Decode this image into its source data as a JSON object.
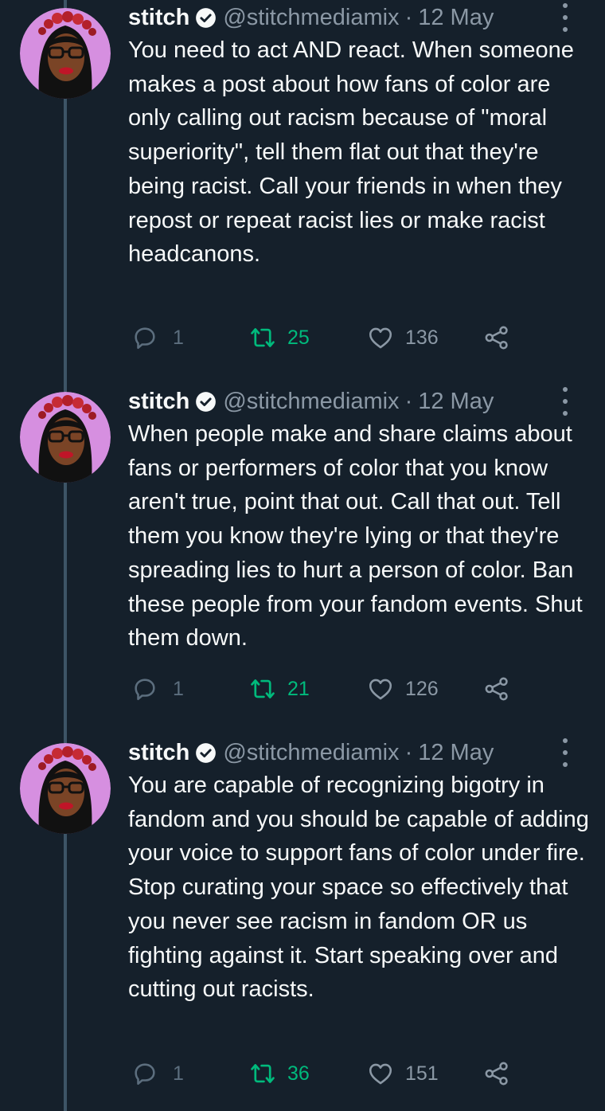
{
  "colors": {
    "background": "#15202b",
    "text_primary": "#f7f9f9",
    "text_secondary": "#8b98a5",
    "retweet_active": "#00ba7c",
    "thread_line": "#3d5466"
  },
  "tweets": [
    {
      "author_name": "stitch",
      "handle": "@stitchmediamix",
      "separator": "·",
      "date": "12 May",
      "text": "You need to act AND react. When someone makes a post about how fans of color are only calling out racism because of \"moral superiority\", tell them flat out that they're being racist. Call your friends in when they repost or repeat racist lies or make racist headcanons.",
      "replies": "1",
      "retweets": "25",
      "likes": "136"
    },
    {
      "author_name": "stitch",
      "handle": "@stitchmediamix",
      "separator": "·",
      "date": "12 May",
      "text": "When people make and share claims about fans or performers of color that you know aren't true, point that out. Call that out. Tell them you know they're lying or that they're spreading lies to hurt a person of color. Ban these people from your fandom events. Shut them down.",
      "replies": "1",
      "retweets": "21",
      "likes": "126"
    },
    {
      "author_name": "stitch",
      "handle": "@stitchmediamix",
      "separator": "·",
      "date": "12 May",
      "text": "You are capable of recognizing bigotry in fandom and you should be capable of adding your voice to support fans of color under fire. Stop curating your space so effectively that you never see racism in fandom OR us fighting against it. Start speaking over and cutting out racists.",
      "replies": "1",
      "retweets": "36",
      "likes": "151"
    }
  ]
}
